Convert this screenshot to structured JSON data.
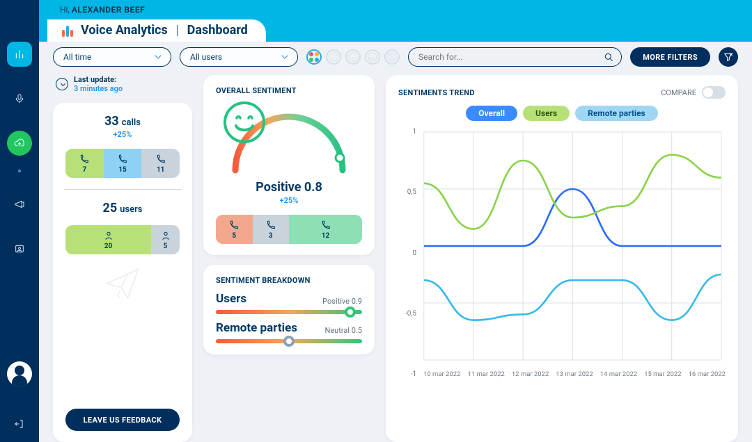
{
  "greeting": {
    "hi": "Hi,",
    "name": "ALEXANDER BEEF"
  },
  "header": {
    "app": "Voice Analytics",
    "sep": "|",
    "page": "Dashboard"
  },
  "filters": {
    "time_label": "All time",
    "user_label": "All users",
    "search_placeholder": "Search for...",
    "more": "MORE FILTERS"
  },
  "last_update": {
    "label": "Last update:",
    "value": "3 minutes ago"
  },
  "stats": {
    "calls": {
      "n": "33",
      "unit": "calls",
      "delta": "+25%",
      "split": [
        "7",
        "15",
        "11"
      ]
    },
    "users": {
      "n": "25",
      "unit": "users",
      "split": [
        "20",
        "5"
      ]
    }
  },
  "feedback_btn": "LEAVE US FEEDBACK",
  "overall": {
    "title": "OVERALL SENTIMENT",
    "label": "Positive 0.8",
    "delta": "+25%",
    "split": [
      "5",
      "3",
      "12"
    ]
  },
  "breakdown": {
    "title": "SENTIMENT BREAKDOWN",
    "rows": [
      {
        "label": "Users",
        "score": "Positive 0.9",
        "knob_pct": 92,
        "knob_color": "#35c47a"
      },
      {
        "label": "Remote parties",
        "score": "Neutral 0.5",
        "knob_pct": 50,
        "knob_color": "#8fa2b2"
      }
    ]
  },
  "trend": {
    "title": "SENTIMENTS TREND",
    "compare": "COMPARE",
    "legend": {
      "overall": "Overall",
      "users": "Users",
      "remote": "Remote parties"
    }
  },
  "chart_data": {
    "type": "line",
    "xlabel": "",
    "ylabel": "",
    "ylim": [
      -1,
      1
    ],
    "x": [
      "10 mar 2022",
      "11 mar 2022",
      "12 mar 2022",
      "13 mar 2022",
      "14 mar 2022",
      "15 mar 2022",
      "16 mar 2022"
    ],
    "yticks": [
      "1",
      "0,5",
      "0",
      "-0,5",
      "-1"
    ],
    "series": [
      {
        "name": "Overall",
        "color": "#2b6bff",
        "values": [
          0.0,
          0.0,
          0.0,
          0.5,
          0.0,
          0.0,
          0.0
        ]
      },
      {
        "name": "Users",
        "color": "#8bd24a",
        "values": [
          0.55,
          0.15,
          0.75,
          0.25,
          0.35,
          0.8,
          0.6
        ]
      },
      {
        "name": "Remote parties",
        "color": "#37b9e8",
        "values": [
          -0.3,
          -0.65,
          -0.6,
          -0.3,
          -0.3,
          -0.65,
          -0.25
        ]
      }
    ]
  }
}
